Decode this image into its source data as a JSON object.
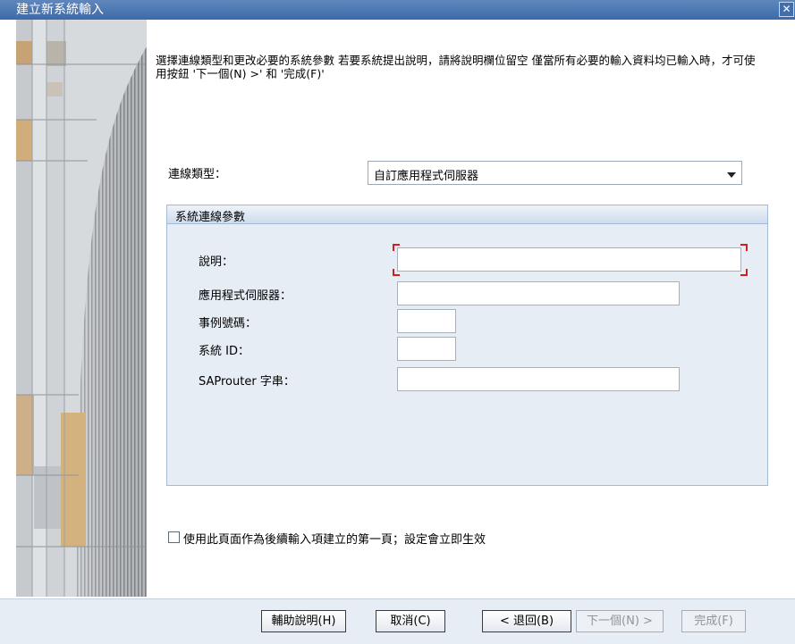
{
  "window": {
    "title": "建立新系統輸入",
    "close_symbol": "✕"
  },
  "instructions": "選擇連線類型和更改必要的系統參數 若要系統提出說明，請將說明欄位留空 僅當所有必要的輸入資料均已輸入時，才可使用按鈕 '下一個(N) >' 和 '完成(F)'",
  "connection_type": {
    "label": "連線類型：",
    "value": "自訂應用程式伺服器"
  },
  "params_group": {
    "title": "系統連線參數",
    "fields": {
      "description": {
        "label": "說明：",
        "value": ""
      },
      "app_server": {
        "label": "應用程式伺服器：",
        "value": ""
      },
      "instance_number": {
        "label": "事例號碼：",
        "value": ""
      },
      "system_id": {
        "label": "系統 ID：",
        "value": ""
      },
      "saprouter": {
        "label": "SAProuter 字串：",
        "value": ""
      }
    }
  },
  "first_page_checkbox": {
    "label": "使用此頁面作為後續輸入項建立的第一頁；設定會立即生效",
    "checked": false
  },
  "buttons": {
    "help": "輔助說明(H)",
    "cancel": "取消(C)",
    "back": "< 退回(B)",
    "next": "下一個(N) >",
    "finish": "完成(F)"
  },
  "colors": {
    "title_bar": "#4471ae",
    "group_background": "#e6edf5",
    "focus_marker": "#d02020"
  }
}
